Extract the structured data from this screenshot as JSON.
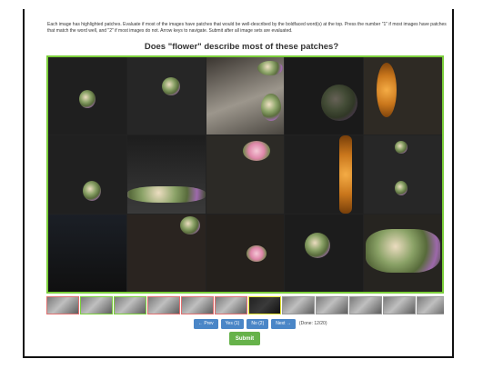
{
  "instructions": "Each image has highlighted patches. Evaluate if most of the images have patches that would be well-described by the boldfaced word(s) at the top. Press the number \"1\" if most images have patches that match the word well, and \"2\" if most images do not. Arrow keys to navigate. Submit after all image sets are evaluated.",
  "question": "Does \"flower\" describe most of these patches?",
  "nav": {
    "prev_label": "← Prev",
    "yes_label": "Yes (1)",
    "no_label": "No (2)",
    "next_label": "Next →",
    "done_text": "(Done: 12/20)"
  },
  "submit_label": "Submit",
  "colors": {
    "grid_border": "#7ccf3c",
    "button_blue": "#4a86c7",
    "submit_green": "#66b24a"
  }
}
